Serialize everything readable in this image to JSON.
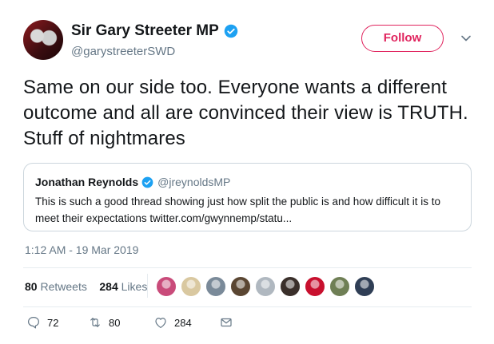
{
  "author": {
    "name": "Sir Gary Streeter MP",
    "handle": "@garystreeterSWD",
    "verified": true
  },
  "follow_label": "Follow",
  "tweet": {
    "text": "Same on our side too. Everyone wants a different outcome and all are convinced their view is TRUTH. Stuff of nightmares"
  },
  "quoted": {
    "name": "Jonathan Reynolds",
    "handle": "@jreynoldsMP",
    "text": "This is such a good thread showing just how split the public is and how difficult it is to meet their expectations twitter.com/gwynnemp/statu..."
  },
  "timestamp": "1:12 AM - 19 Mar 2019",
  "stats": {
    "retweets_count": "80",
    "retweets_label": "Retweets",
    "likes_count": "284",
    "likes_label": "Likes"
  },
  "likers": [
    {
      "name": "liker-avatar-1",
      "color": "#c94b7a"
    },
    {
      "name": "liker-avatar-2",
      "color": "#d9c8a0"
    },
    {
      "name": "liker-avatar-3",
      "color": "#7a8a99"
    },
    {
      "name": "liker-avatar-4",
      "color": "#5a4632"
    },
    {
      "name": "liker-avatar-5",
      "color": "#b0b8c0"
    },
    {
      "name": "liker-avatar-6",
      "color": "#3a2f2a"
    },
    {
      "name": "liker-avatar-7",
      "color": "#c8102e"
    },
    {
      "name": "liker-avatar-8",
      "color": "#6f7f55"
    },
    {
      "name": "liker-avatar-9",
      "color": "#2f3e55"
    }
  ],
  "actions": {
    "reply_count": "72",
    "retweet_count": "80",
    "like_count": "284"
  },
  "colors": {
    "accent": "#e0245e",
    "verified": "#1da1f2",
    "muted": "#657786",
    "border": "#ccd6dd"
  }
}
